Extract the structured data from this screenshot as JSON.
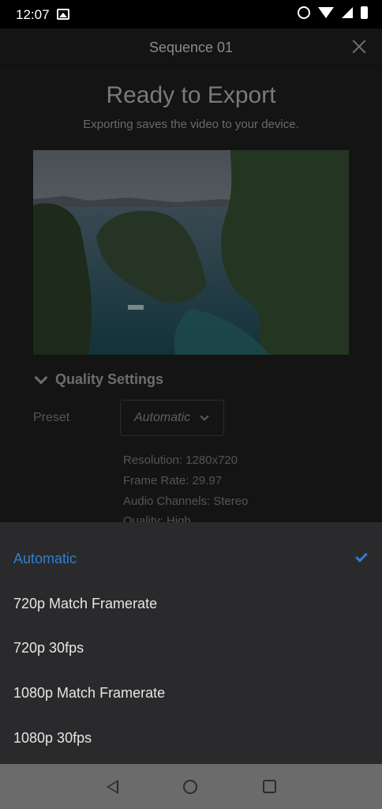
{
  "status_bar": {
    "time": "12:07"
  },
  "header": {
    "title": "Sequence 01"
  },
  "export": {
    "title": "Ready to Export",
    "subtitle": "Exporting saves the video to your device."
  },
  "quality": {
    "section_label": "Quality Settings",
    "preset_label": "Preset",
    "preset_value": "Automatic",
    "resolution": "Resolution: 1280x720",
    "frame_rate": "Frame Rate: 29.97",
    "audio_channels": "Audio Channels: Stereo",
    "quality": "Quality: High"
  },
  "preset_options": [
    {
      "label": "Automatic",
      "selected": true
    },
    {
      "label": "720p Match Framerate",
      "selected": false
    },
    {
      "label": "720p 30fps",
      "selected": false
    },
    {
      "label": "1080p Match Framerate",
      "selected": false
    },
    {
      "label": "1080p 30fps",
      "selected": false
    }
  ],
  "colors": {
    "accent": "#2e7fd0",
    "sheet": "#2a2a2c",
    "navbar": "#6b6b6b"
  }
}
